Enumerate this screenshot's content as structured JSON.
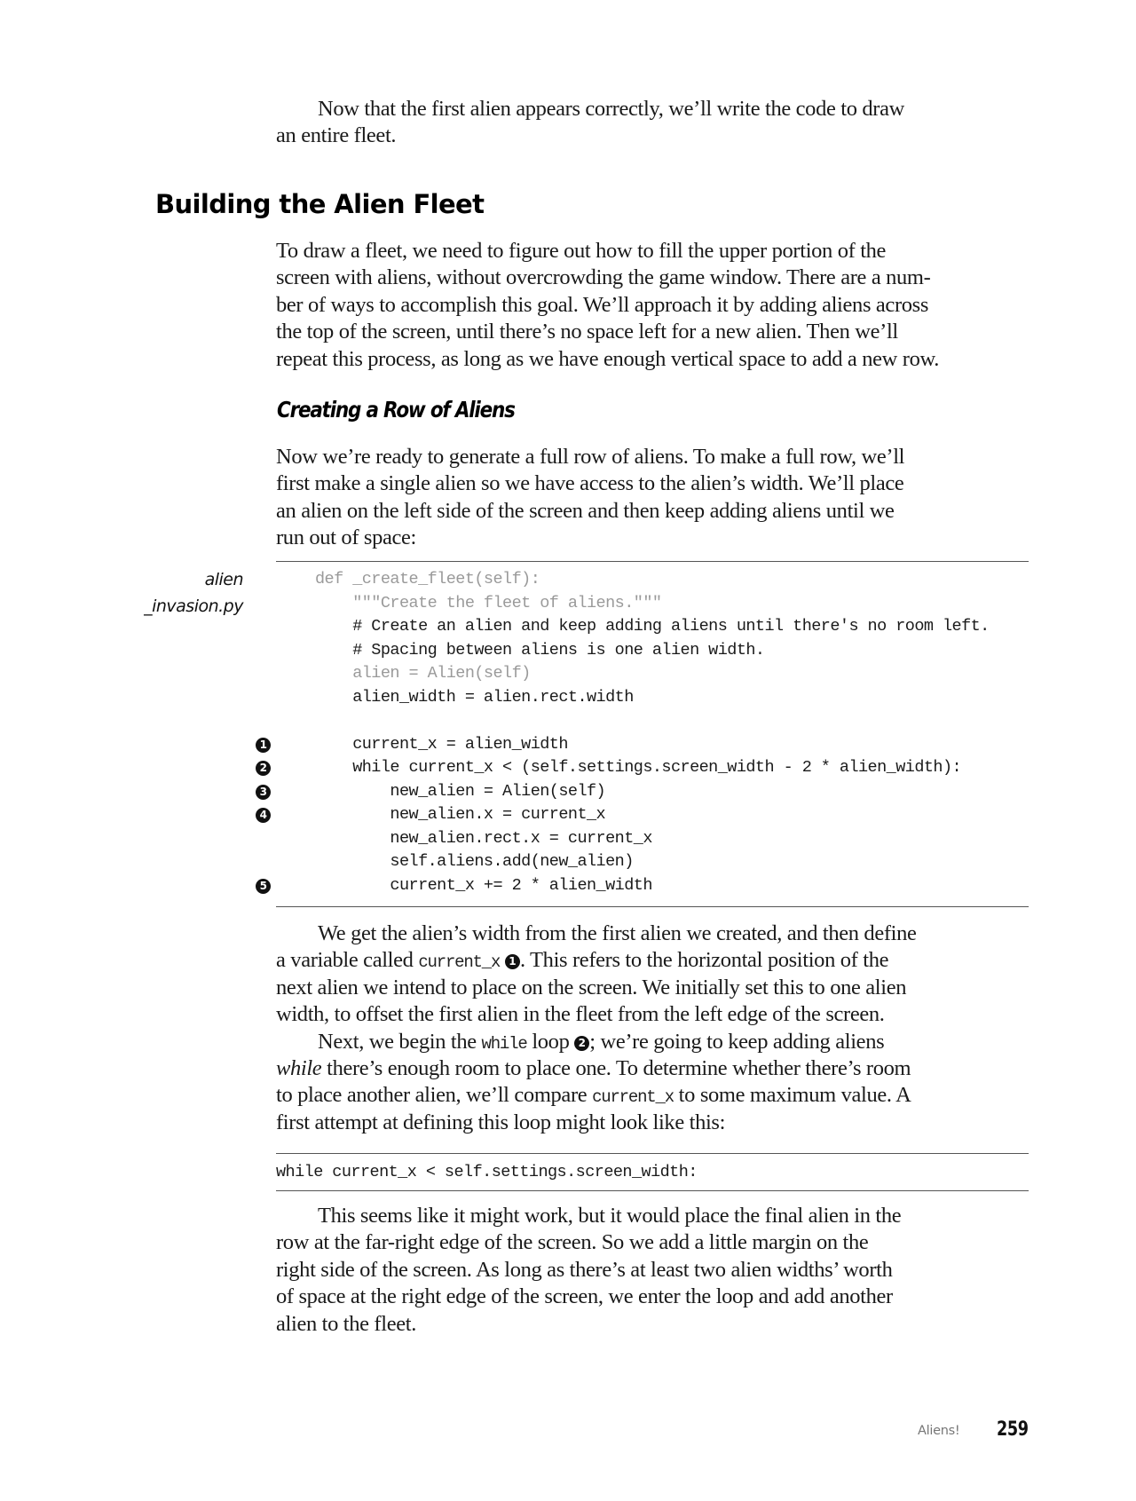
{
  "intro": {
    "lines": [
      "Now that the first alien appears correctly, we’ll write the code to draw",
      "an entire fleet."
    ]
  },
  "section": {
    "heading": "Building the Alien Fleet",
    "paragraph_lines": [
      "To draw a fleet, we need to figure out how to fill the upper portion of the",
      "screen with aliens, without overcrowding the game window. There are a num-",
      "ber of ways to accomplish this goal. We’ll approach it by adding aliens across",
      "the top of the screen, until there’s no space left for a new alien. Then we’ll",
      "repeat this process, as long as we have enough vertical space to add a new row."
    ]
  },
  "subsection": {
    "heading": "Creating a Row of Aliens",
    "paragraph_lines": [
      "Now we’re ready to generate a full row of aliens. To make a full row, we’ll",
      "first make a single alien so we have access to the alien’s width. We’ll place",
      "an alien on the left side of the screen and then keep adding aliens until we",
      "run out of space:"
    ]
  },
  "code_listing": {
    "filename_line1": "alien",
    "filename_line2": "_invasion.py",
    "lines": [
      {
        "text": "def _create_fleet(self):",
        "style": "old",
        "callout": ""
      },
      {
        "text": "    \"\"\"Create the fleet of aliens.\"\"\"",
        "style": "old",
        "callout": ""
      },
      {
        "text": "    # Create an alien and keep adding aliens until there's no room left.",
        "style": "new",
        "callout": ""
      },
      {
        "text": "    # Spacing between aliens is one alien width.",
        "style": "new",
        "callout": ""
      },
      {
        "text": "    alien = Alien(self)",
        "style": "old",
        "callout": ""
      },
      {
        "text": "    alien_width = alien.rect.width",
        "style": "new",
        "callout": ""
      },
      {
        "text": "",
        "style": "new",
        "callout": ""
      },
      {
        "text": "    current_x = alien_width",
        "style": "new",
        "callout": "1"
      },
      {
        "text": "    while current_x < (self.settings.screen_width - 2 * alien_width):",
        "style": "new",
        "callout": "2"
      },
      {
        "text": "        new_alien = Alien(self)",
        "style": "new",
        "callout": "3"
      },
      {
        "text": "        new_alien.x = current_x",
        "style": "new",
        "callout": "4"
      },
      {
        "text": "        new_alien.rect.x = current_x",
        "style": "new",
        "callout": ""
      },
      {
        "text": "        self.aliens.add(new_alien)",
        "style": "new",
        "callout": ""
      },
      {
        "text": "        current_x += 2 * alien_width",
        "style": "new",
        "callout": "5"
      }
    ]
  },
  "explanation": {
    "p1": {
      "l1": "We get the alien’s width from the first alien we created, and then define",
      "l2_pre": "a variable called ",
      "l2_code": "current_x",
      "l2_callout": "1",
      "l2_post": ". This refers to the horizontal position of the",
      "l3": "next alien we intend to place on the screen. We initially set this to one alien",
      "l4": "width, to offset the first alien in the fleet from the left edge of the screen."
    },
    "p2": {
      "l1_pre": "Next, we begin the ",
      "l1_code": "while",
      "l1_mid": " loop ",
      "l1_callout": "2",
      "l1_post": "; we’re going to keep adding aliens",
      "l2_em": "while",
      "l2_post": " there’s enough room to place one. To determine whether there’s room",
      "l3_pre": "to place another alien, we’ll compare ",
      "l3_code": "current_x",
      "l3_post": " to some maximum value. A",
      "l4": "first attempt at defining this loop might look like this:"
    }
  },
  "first_attempt_code": "while current_x < self.settings.screen_width:",
  "conclusion": {
    "lines": [
      "This seems like it might work, but it would place the final alien in the",
      "row at the far-right edge of the screen. So we add a little margin on the",
      "right side of the screen. As long as there’s at least two alien widths’ worth",
      "of space at the right edge of the screen, we enter the loop and add another",
      "alien to the fleet."
    ]
  },
  "footer": {
    "chapter": "Aliens!",
    "page_number": "259"
  },
  "colors": {
    "text": "#1a1a1a",
    "old_code": "#9a9a9a",
    "rule": "#555555",
    "footer_label": "#777777"
  }
}
